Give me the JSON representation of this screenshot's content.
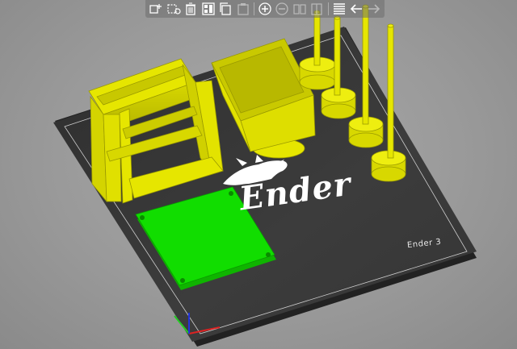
{
  "toolbar": {
    "buttons": [
      {
        "name": "add-icon",
        "enabled": true
      },
      {
        "name": "add-shape-icon",
        "enabled": true
      },
      {
        "name": "delete-icon",
        "enabled": true
      },
      {
        "name": "arrange-icon",
        "enabled": true
      },
      {
        "name": "copy-icon",
        "enabled": true
      },
      {
        "name": "paste-icon",
        "enabled": false
      },
      {
        "name": "add-instance-icon",
        "enabled": true
      },
      {
        "name": "remove-instance-icon",
        "enabled": false
      },
      {
        "name": "split-objects-icon",
        "enabled": false
      },
      {
        "name": "split-parts-icon",
        "enabled": false
      },
      {
        "name": "layers-icon",
        "enabled": true
      },
      {
        "name": "undo-icon",
        "enabled": true
      },
      {
        "name": "redo-icon",
        "enabled": false
      }
    ]
  },
  "bed": {
    "logo_text": "Ender",
    "label": "Ender 3"
  },
  "colors": {
    "bed": "#3a3a3a",
    "object_default": "#e6e600",
    "object_selected": "#11dd00",
    "axis_x": "#dd2222",
    "axis_y": "#22cc22",
    "axis_z": "#2233dd"
  }
}
